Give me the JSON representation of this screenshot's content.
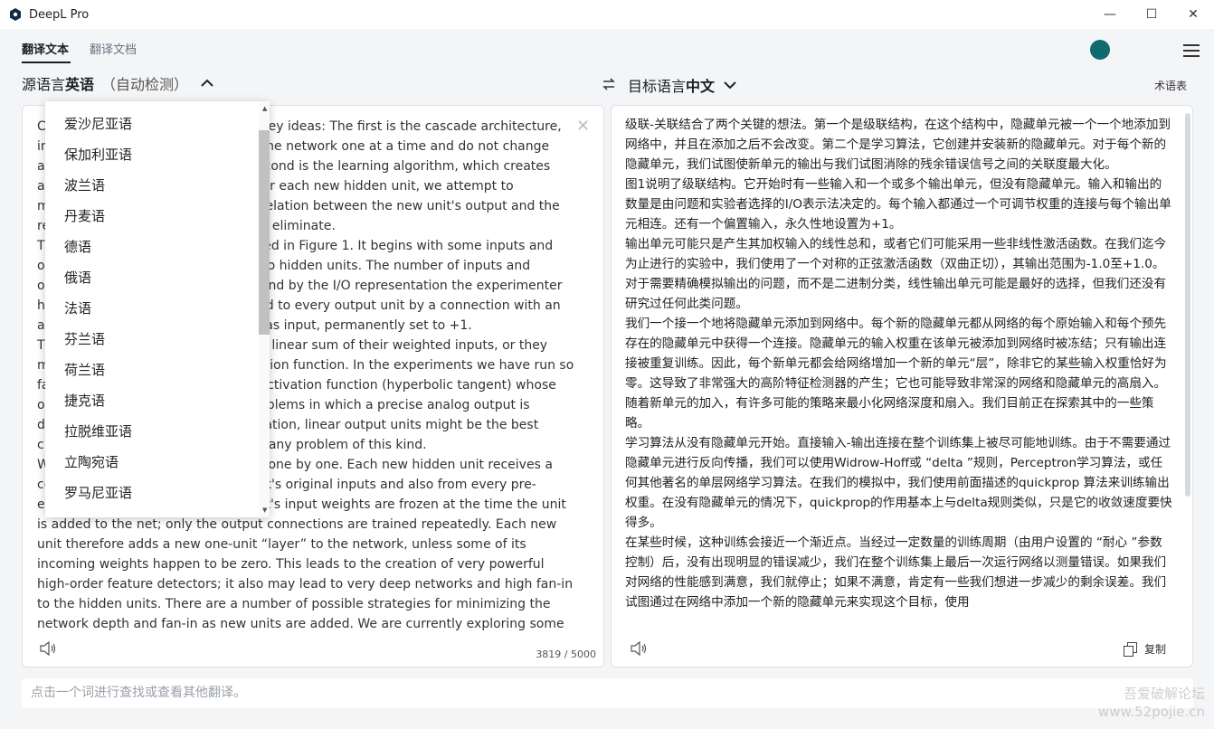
{
  "window": {
    "title": "DeepL Pro",
    "controls": {
      "minimize": "—",
      "maximize": "☐",
      "close": "✕"
    }
  },
  "tabs": [
    {
      "label": "翻译文本",
      "active": true
    },
    {
      "label": "翻译文档",
      "active": false
    }
  ],
  "source_lang": {
    "prefix": "源语言",
    "name": "英语",
    "detect": "（自动检测）"
  },
  "target_lang": {
    "prefix": "目标语言",
    "name": "中文"
  },
  "glossary_label": "术语表",
  "source_text": "Cascade-Correlation combines two key ideas: The first is the cascade architecture, in which hidden units are added to the network one at a time and do not change after they have been added. The second is the learning algorithm, which creates and installs the new hidden units. For each new hidden unit, we attempt to maximize the magnitude of the correlation between the new unit's output and the residual error signal we are trying to eliminate.\nThe cascade architecture is illustrated in Figure 1. It begins with some inputs and one or more output units, but with no hidden units. The number of inputs and outputs is dictated by the problem and by the I/O representation the experimenter has chosen. Every input is connected to every output unit by a connection with an adjustable weight. There is also a bias input, permanently set to +1.\nThe output units may just produce a linear sum of their weighted inputs, or they may employ some non-linear activation function. In the experiments we have run so far, we use a symmetric sigmoidal activation function (hyperbolic tangent) whose output range is -1.0 to +1.0. For problems in which a precise analog output is desired, instead of a binary classification, linear output units might be the best choice, but we have not yet studied any problem of this kind.\nWe add hidden units to the network one by one. Each new hidden unit receives a connection from each of the network's original inputs and also from every pre-existing hidden unit. The hidden unit's input weights are frozen at the time the unit is added to the net; only the output connections are trained repeatedly. Each new unit therefore adds a new one-unit “layer” to the network, unless some of its incoming weights happen to be zero. This leads to the creation of very powerful high-order feature detectors; it also may lead to very deep networks and high fan-in to the hidden units. There are a number of possible strategies for minimizing the network depth and fan-in as new units are added. We are currently exploring some of these strategies.",
  "char_count": "3819 / 5000",
  "target_text": "级联-关联结合了两个关键的想法。第一个是级联结构，在这个结构中，隐藏单元被一个一个地添加到网络中，并且在添加之后不会改变。第二个是学习算法，它创建并安装新的隐藏单元。对于每个新的隐藏单元，我们试图使新单元的输出与我们试图消除的残余错误信号之间的关联度最大化。\n图1说明了级联结构。它开始时有一些输入和一个或多个输出单元，但没有隐藏单元。输入和输出的数量是由问题和实验者选择的I/O表示法决定的。每个输入都通过一个可调节权重的连接与每个输出单元相连。还有一个偏置输入，永久性地设置为+1。\n输出单元可能只是产生其加权输入的线性总和，或者它们可能采用一些非线性激活函数。在我们迄今为止进行的实验中，我们使用了一个对称的正弦激活函数（双曲正切），其输出范围为-1.0至+1.0。对于需要精确模拟输出的问题，而不是二进制分类，线性输出单元可能是最好的选择，但我们还没有研究过任何此类问题。\n我们一个接一个地将隐藏单元添加到网络中。每个新的隐藏单元都从网络的每个原始输入和每个预先存在的隐藏单元中获得一个连接。隐藏单元的输入权重在该单元被添加到网络时被冻结；只有输出连接被重复训练。因此，每个新单元都会给网络增加一个新的单元“层”，除非它的某些输入权重恰好为零。这导致了非常强大的高阶特征检测器的产生；它也可能导致非常深的网络和隐藏单元的高扇入。随着新单元的加入，有许多可能的策略来最小化网络深度和扇入。我们目前正在探索其中的一些策略。\n学习算法从没有隐藏单元开始。直接输入-输出连接在整个训练集上被尽可能地训练。由于不需要通过隐藏单元进行反向传播，我们可以使用Widrow-Hoff或 “delta ”规则，Perceptron学习算法，或任何其他著名的单层网络学习算法。在我们的模拟中，我们使用前面描述的quickprop 算法来训练输出权重。在没有隐藏单元的情况下，quickprop的作用基本上与delta规则类似，只是它的收敛速度要快得多。\n在某些时候，这种训练会接近一个渐近点。当经过一定数量的训练周期（由用户设置的 “耐心 ”参数控制）后，没有出现明显的错误减少，我们在整个训练集上最后一次运行网络以测量错误。如果我们对网络的性能感到满意，我们就停止；如果不满意，肯定有一些我们想进一步减少的剩余误差。我们试图通过在网络中添加一个新的隐藏单元来实现这个目标，使用",
  "copy_label": "复制",
  "dropdown": {
    "items": [
      "爱沙尼亚语",
      "保加利亚语",
      "波兰语",
      "丹麦语",
      "德语",
      "俄语",
      "法语",
      "芬兰语",
      "荷兰语",
      "捷克语",
      "拉脱维亚语",
      "立陶宛语",
      "罗马尼亚语"
    ]
  },
  "lookup_placeholder": "点击一个词进行查找或查看其他翻译。",
  "watermark": {
    "line1": "吾爱破解论坛",
    "line2": "www.52pojie.cn"
  },
  "colors": {
    "avatar": "#0f6b6e",
    "accent": "#1b1e25"
  }
}
